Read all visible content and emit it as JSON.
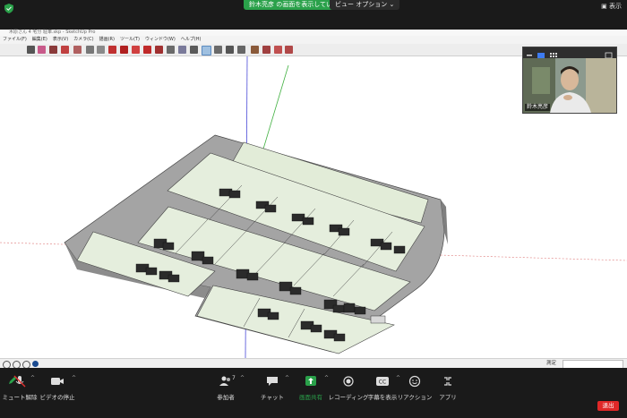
{
  "zoom": {
    "share_banner": "鈴木亮彦 の画面を表示しています",
    "view_options": "ビュー オプション",
    "display_label": "表示",
    "participant_name": "鈴木亮彦",
    "participants_count": "7",
    "controls": {
      "mute": "ミュート解除",
      "video": "ビデオの停止",
      "participants": "参加者",
      "chat": "チャット",
      "share": "画面共有",
      "record": "レコーディング",
      "captions": "字幕を表示",
      "reactions": "リアクション",
      "apps": "アプリ",
      "leave": "退出"
    },
    "colors": {
      "share_green": "#2aa14a",
      "leave_red": "#e02828"
    }
  },
  "sketchup": {
    "title": "木原さん 4 宅分 駐車.skp - SketchUp Pro",
    "menus": [
      "ファイル(F)",
      "編集(E)",
      "表示(V)",
      "カメラ(C)",
      "描画(R)",
      "ツール(T)",
      "ウィンドウ(W)",
      "ヘルプ(H)"
    ],
    "measure_label": "測定"
  }
}
